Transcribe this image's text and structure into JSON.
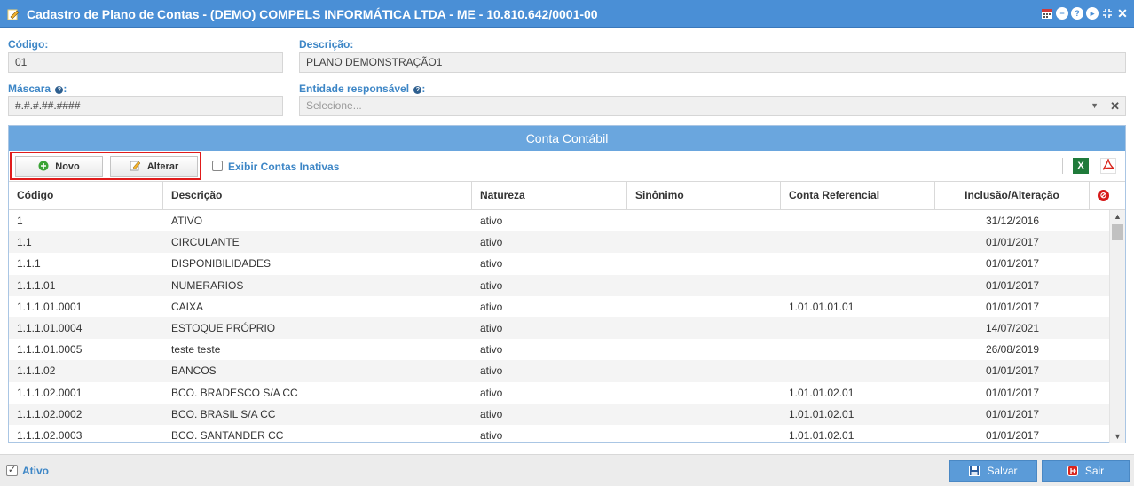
{
  "window": {
    "title": "Cadastro de Plano de Contas - (DEMO) COMPELS INFORMÁTICA LTDA - ME - 10.810.642/0001-00",
    "icons": [
      "calendar-icon",
      "minimize-icon",
      "help-icon",
      "play-icon",
      "resize-icon",
      "close-icon"
    ]
  },
  "form": {
    "codigo_label": "Código:",
    "codigo_value": "01",
    "descricao_label": "Descrição:",
    "descricao_value": "PLANO DEMONSTRAÇÃO1",
    "mascara_label": "Máscara",
    "mascara_value": "#.#.#.##.####",
    "entidade_label": "Entidade responsável",
    "entidade_placeholder": "Selecione..."
  },
  "panel": {
    "title": "Conta Contábil",
    "novo_label": "Novo",
    "alterar_label": "Alterar",
    "inativas_label": "Exibir Contas Inativas",
    "excel_glyph": "X"
  },
  "table": {
    "headers": [
      "Código",
      "Descrição",
      "Natureza",
      "Sinônimo",
      "Conta Referencial",
      "Inclusão/Alteração"
    ],
    "rows": [
      [
        "1",
        "ATIVO",
        "ativo",
        "",
        "",
        "31/12/2016"
      ],
      [
        "1.1",
        "CIRCULANTE",
        "ativo",
        "",
        "",
        "01/01/2017"
      ],
      [
        "1.1.1",
        "DISPONIBILIDADES",
        "ativo",
        "",
        "",
        "01/01/2017"
      ],
      [
        "1.1.1.01",
        "NUMERARIOS",
        "ativo",
        "",
        "",
        "01/01/2017"
      ],
      [
        "1.1.1.01.0001",
        "CAIXA",
        "ativo",
        "",
        "1.01.01.01.01",
        "01/01/2017"
      ],
      [
        "1.1.1.01.0004",
        "ESTOQUE PRÓPRIO",
        "ativo",
        "",
        "",
        "14/07/2021"
      ],
      [
        "1.1.1.01.0005",
        "teste teste",
        "ativo",
        "",
        "",
        "26/08/2019"
      ],
      [
        "1.1.1.02",
        "BANCOS",
        "ativo",
        "",
        "",
        "01/01/2017"
      ],
      [
        "1.1.1.02.0001",
        "BCO. BRADESCO S/A CC",
        "ativo",
        "",
        "1.01.01.02.01",
        "01/01/2017"
      ],
      [
        "1.1.1.02.0002",
        "BCO. BRASIL S/A CC",
        "ativo",
        "",
        "1.01.01.02.01",
        "01/01/2017"
      ],
      [
        "1.1.1.02.0003",
        "BCO. SANTANDER CC",
        "ativo",
        "",
        "1.01.01.02.01",
        "01/01/2017"
      ]
    ]
  },
  "footer": {
    "ativo_label": "Ativo",
    "salvar_label": "Salvar",
    "sair_label": "Sair"
  },
  "colors": {
    "titlebar": "#4a8fd6",
    "label": "#3d86c6",
    "panel_header": "#6aa6de",
    "highlight": "#e01b1b",
    "footer_button": "#5b9bd8"
  }
}
